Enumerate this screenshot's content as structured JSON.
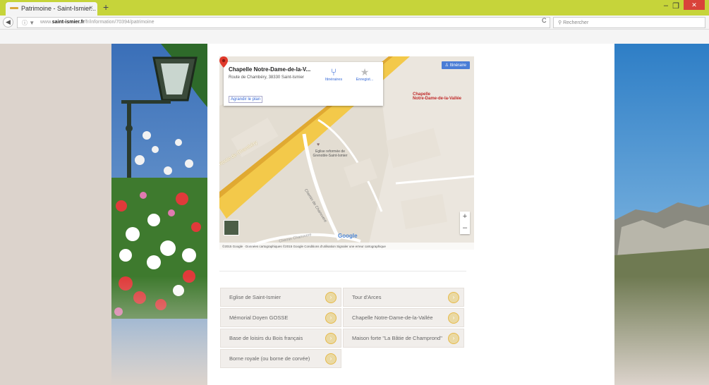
{
  "browser": {
    "tab_title": "Patrimoine - Saint-Ismier...",
    "tab_close": "×",
    "new_tab": "+",
    "win_min": "–",
    "win_max": "❐",
    "win_close": "✕",
    "back": "◀",
    "url_icons": "ⓘ ▼",
    "url_prefix": "www.",
    "url_domain": "saint-ismier.fr",
    "url_path": "/fr/information/70394/patrimoine",
    "reload": "C",
    "search_placeholder": "Rechercher",
    "search_icon": "⚲",
    "accent_color": "#c6d43a"
  },
  "map": {
    "place_name": "Chapelle Notre-Dame-de-la-V...",
    "address": "Route de Chambéry, 38330 Saint-Ismier",
    "enlarge_label": "Agrandir le plan",
    "itinerary_label": "Itinéraires",
    "save_label": "Enregist...",
    "directions_label": "Itinéraire",
    "pin_label_line1": "Chapelle",
    "pin_label_line2": "Notre-Dame-de-la-Vallée",
    "road_label": "Route de Chambéry",
    "poi_label": "Eglise reformée de Grenoble-Saint-Ismier",
    "street_label": "Chemin de Chanvvere",
    "street_label2": "Chemin Chanvvere",
    "zoom_in": "+",
    "zoom_out": "–",
    "google_logo": "Google",
    "footer": "©2015 Google · Données cartographiques ©2015 Google    Conditions d'utilisation    Signaler une erreur cartographique"
  },
  "links": [
    {
      "label": "Eglise de Saint-Ismier",
      "arrow": "›"
    },
    {
      "label": "Tour d'Arces",
      "arrow": "›"
    },
    {
      "label": "Mémorial Doyen GOSSE",
      "arrow": "›"
    },
    {
      "label": "Chapelle Notre-Dame-de-la-Vallée",
      "arrow": "›"
    },
    {
      "label": "Base de loisirs du Bois français",
      "arrow": "›"
    },
    {
      "label": "Maison forte \"La Bâtie de Champrond\"",
      "arrow": "›"
    },
    {
      "label": "Borne royale (ou borne de corvée)",
      "arrow": "›"
    }
  ]
}
